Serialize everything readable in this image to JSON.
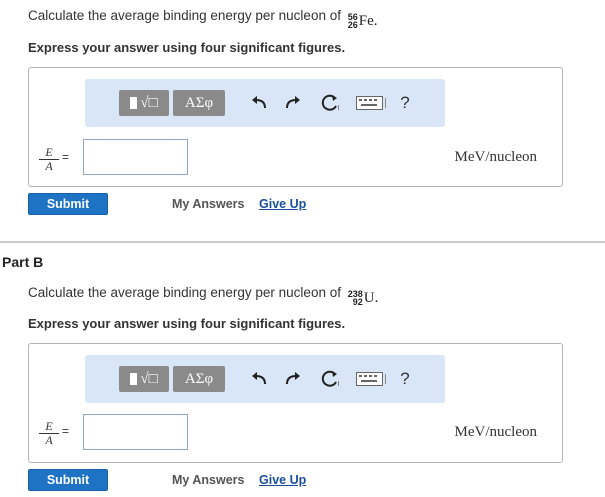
{
  "part_a": {
    "prompt": "Calculate the average binding energy per nucleon of",
    "nuclide": {
      "mass": "56",
      "atomic": "26",
      "symbol": "Fe",
      "trailing": "."
    },
    "instruction": "Express your answer using four significant figures.",
    "toolbar": {
      "template_label": "√□",
      "greek_label": "ΑΣφ",
      "help_label": "?"
    },
    "lhs": {
      "numerator": "E",
      "denominator": "A",
      "equals": "="
    },
    "input_value": "",
    "unit": "MeV/nucleon",
    "submit_label": "Submit",
    "my_answers_label": "My Answers",
    "give_up_label": "Give Up"
  },
  "part_b": {
    "title": "Part B",
    "prompt": "Calculate the average binding energy per nucleon of",
    "nuclide": {
      "mass": "238",
      "atomic": "92",
      "symbol": "U",
      "trailing": "."
    },
    "instruction": "Express your answer using four significant figures.",
    "toolbar": {
      "template_label": "√□",
      "greek_label": "ΑΣφ",
      "help_label": "?"
    },
    "lhs": {
      "numerator": "E",
      "denominator": "A",
      "equals": "="
    },
    "input_value": "",
    "unit": "MeV/nucleon",
    "submit_label": "Submit",
    "my_answers_label": "My Answers",
    "give_up_label": "Give Up"
  },
  "colors": {
    "submit_bg": "#1f73c5",
    "toolbar_bg": "#d8e6f7",
    "link": "#1a4fa0"
  }
}
